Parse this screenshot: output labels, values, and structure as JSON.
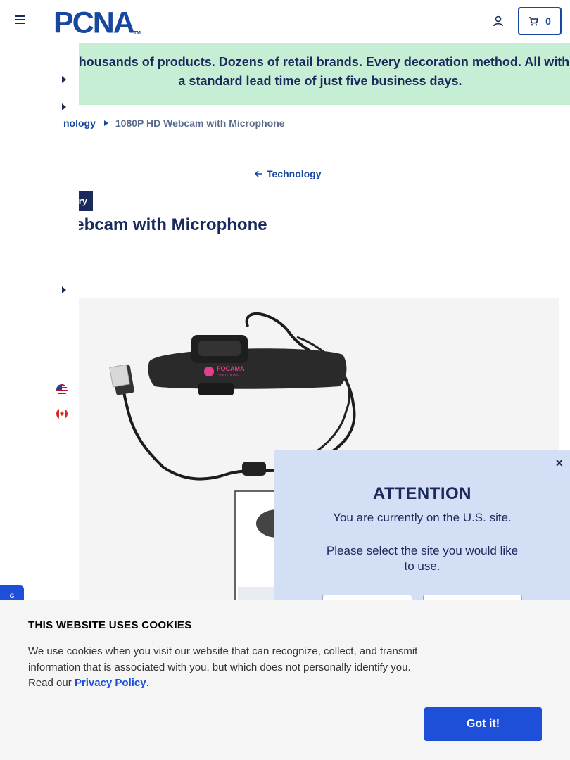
{
  "header": {
    "logo_text": "PCNA",
    "logo_tm": "TM",
    "cart_count": "0"
  },
  "banner": {
    "text": "Thousands of products. Dozens of retail brands. Every decoration method. All with a standard lead time of just five business days."
  },
  "breadcrumb": {
    "parent": "nology",
    "current": "1080P HD Webcam with Microphone"
  },
  "back_link": "Technology",
  "tag_label": "ry",
  "product_title": "D Webcam with Microphone",
  "product_image": {
    "imprint_line1": "FOCAMA",
    "imprint_line2": "SOLUTIONS"
  },
  "attention": {
    "title": "ATTENTION",
    "message1": "You are currently on the U.S. site.",
    "message2": "Please select the site you would like to use.",
    "close": "×"
  },
  "feedback_tab": "G",
  "cookie": {
    "title": "THIS WEBSITE USES COOKIES",
    "text": "We use cookies when you visit our website that can recognize, collect, and transmit information that is associated with you, but which does not personally identify you. Read our ",
    "link": "Privacy Policy",
    "period": ".",
    "button": "Got it!"
  },
  "colors": {
    "brand_blue": "#17479e",
    "navy": "#1b2a5c",
    "banner_green": "#c6eed4",
    "modal_bg": "#d3dff5",
    "cta_blue": "#1d4fd8"
  }
}
